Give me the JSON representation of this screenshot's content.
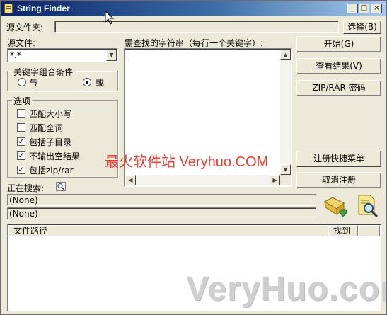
{
  "window": {
    "title": "String Finder",
    "minimize": "_",
    "maximize": "□",
    "close": "×"
  },
  "source_folder": {
    "label": "源文件夹:",
    "value": "",
    "browse_button": "选择(B)"
  },
  "source_file": {
    "label": "源文件:",
    "value": "*.*"
  },
  "keywords": {
    "label": "需查找的字符串（每行一个关键字）:",
    "value": ""
  },
  "combine": {
    "title": "关键字组合条件",
    "and_label": "与",
    "or_label": "或",
    "selected": "or"
  },
  "options": {
    "title": "选项",
    "items": [
      {
        "label": "匹配大小写",
        "checked": false
      },
      {
        "label": "匹配全词",
        "checked": false
      },
      {
        "label": "包括子目录",
        "checked": true
      },
      {
        "label": "不输出空结果",
        "checked": true
      },
      {
        "label": "包括zip/rar",
        "checked": true
      }
    ]
  },
  "buttons": {
    "start": "开始(G)",
    "view_results": "查看结果(V)",
    "zip_password": "ZIP/RAR 密码",
    "register_menu": "注册快捷菜单",
    "unregister": "取消注册"
  },
  "status": {
    "searching_label": "正在搜索:",
    "line1": "(None)",
    "line2": "(None)"
  },
  "results": {
    "columns": [
      "文件路径",
      "找到"
    ],
    "rows": []
  },
  "watermarks": {
    "top": "最火软件站 Veryhuo.COM",
    "bottom": "VeryHuo.com"
  }
}
